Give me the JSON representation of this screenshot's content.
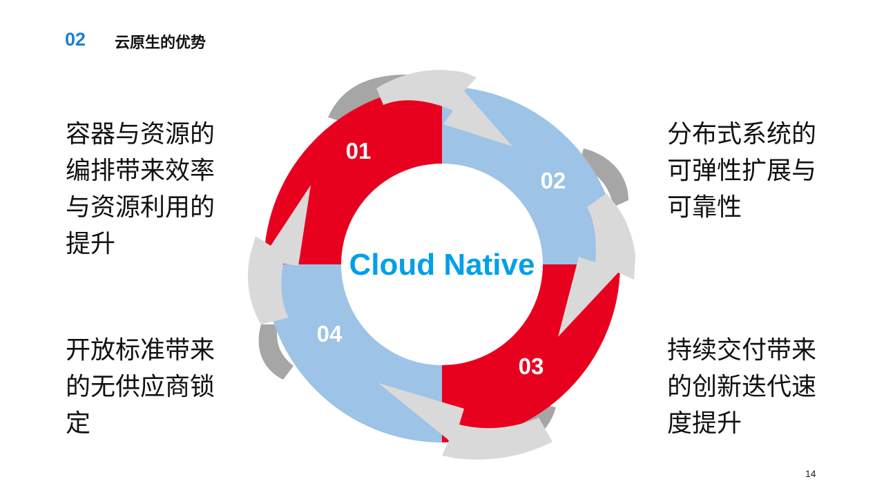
{
  "header": {
    "section_number": "02",
    "title": "云原生的优势"
  },
  "diagram": {
    "center_label": "Cloud Native",
    "segments": [
      {
        "label": "01",
        "text": "容器与资源的编排带来效率与资源利用的提升",
        "color": "#e8001f"
      },
      {
        "label": "02",
        "text": "分布式系统的可弹性扩展与可靠性",
        "color": "#9dc3e6"
      },
      {
        "label": "03",
        "text": "持续交付带来的创新迭代速度提升",
        "color": "#e8001f"
      },
      {
        "label": "04",
        "text": "开放标准带来的无供应商锁定",
        "color": "#9dc3e6"
      }
    ],
    "center_label_color": "#00a0e9",
    "arrow_color": "#d9d9d9",
    "arrow_shadow_color": "#a6a6a6"
  },
  "page_number": "14"
}
